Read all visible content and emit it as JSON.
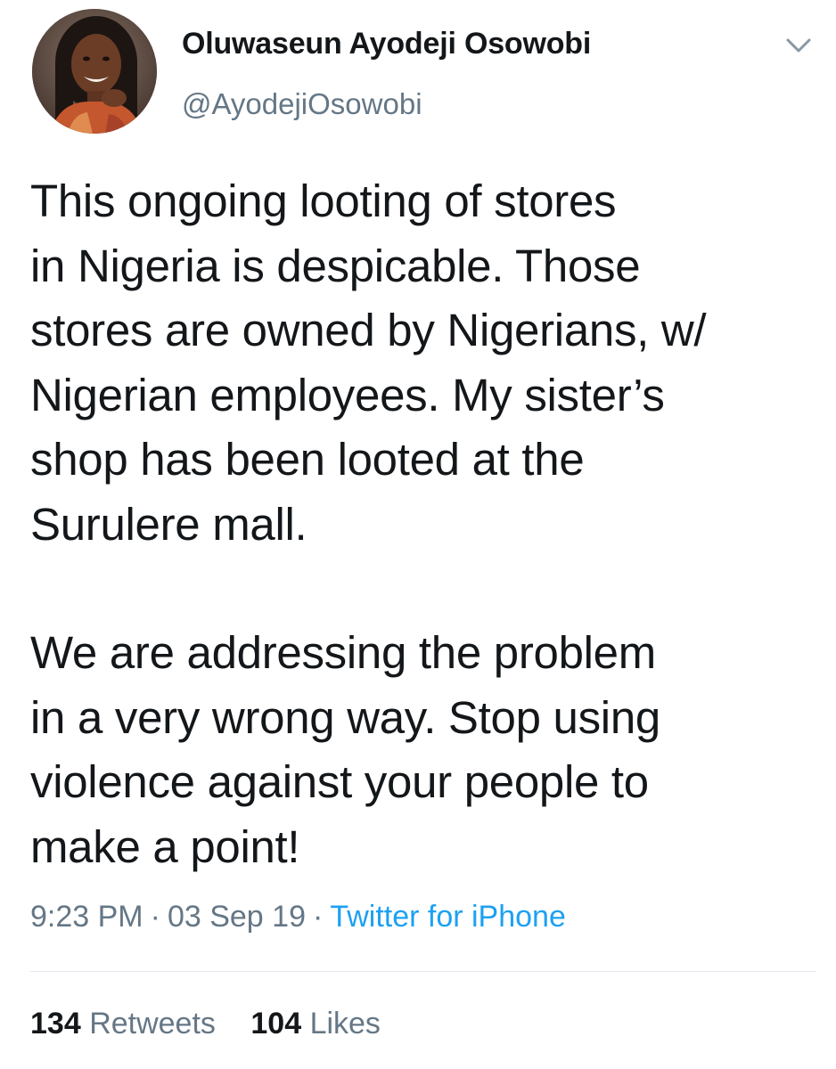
{
  "tweet": {
    "author": {
      "display_name": "Oluwaseun Ayodeji Osowobi",
      "handle": "@AyodejiOsowobi",
      "avatar_icon": "profile-photo"
    },
    "menu_icon": "chevron-down-icon",
    "paragraphs": [
      "This ongoing looting of stores\nin Nigeria is despicable. Those\nstores are owned by Nigerians, w/\nNigerian employees. My sister’s\nshop has been looted at the\nSurulere mall.",
      "We are addressing the problem\nin a very wrong way. Stop using\nviolence against your people to\nmake a point!"
    ],
    "time": "9:23 PM",
    "separator": "·",
    "date": "03 Sep 19",
    "source": "Twitter for iPhone",
    "retweets": {
      "count": "134",
      "label": "Retweets"
    },
    "likes": {
      "count": "104",
      "label": "Likes"
    }
  },
  "colors": {
    "text": "#14171a",
    "secondary": "#657786",
    "link": "#1da1f2",
    "divider": "#e1e8ed"
  }
}
